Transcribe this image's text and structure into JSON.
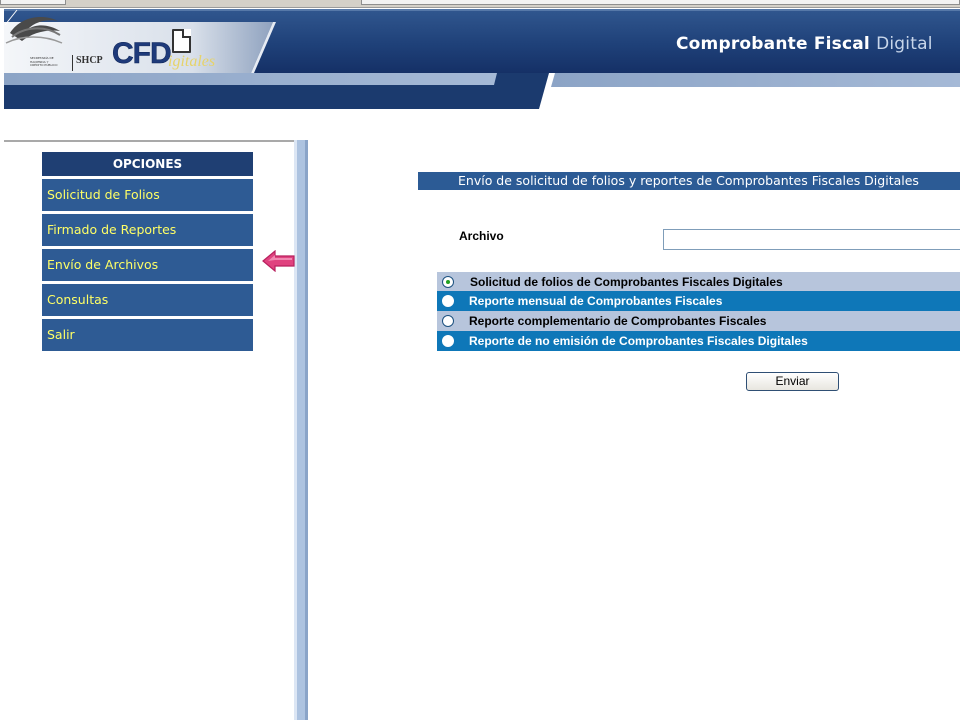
{
  "header": {
    "seal_lines": [
      "SECRETARÍA DE",
      "HACIENDA Y",
      "CRÉDITO PÚBLICO"
    ],
    "seal_abbrev": "SHCP",
    "cfd_letters": "CFD",
    "cfd_script": "igitales",
    "site_title_main": "Comprobante Fiscal ",
    "site_title_accent": "Digital"
  },
  "menu": {
    "header": "OPCIONES",
    "items": [
      {
        "label": "Solicitud de Folios"
      },
      {
        "label": "Firmado de Reportes"
      },
      {
        "label": "Envío de Archivos"
      },
      {
        "label": "Consultas"
      },
      {
        "label": "Salir"
      }
    ]
  },
  "content": {
    "section_title": "Envío de solicitud de folios y reportes de Comprobantes Fiscales Digitales",
    "file_label": "Archivo",
    "file_value": "",
    "options": [
      {
        "label": "Solicitud de folios de Comprobantes Fiscales Digitales",
        "checked": true
      },
      {
        "label": "Reporte mensual de Comprobantes Fiscales",
        "checked": false
      },
      {
        "label": "Reporte complementario de Comprobantes Fiscales",
        "checked": false
      },
      {
        "label": "Reporte de no emisión de Comprobantes Fiscales Digitales",
        "checked": false
      }
    ],
    "submit_label": "Enviar"
  },
  "colors": {
    "banner_dark": "#1b3a6e",
    "menu_header": "#1f3f73",
    "menu_item": "#2e5b94",
    "menu_text": "#ffff66",
    "option_light": "#b7c5dc",
    "option_dark": "#0e77b8",
    "arrow": "#e0427f"
  },
  "icons": {
    "pointer": "left-arrow-icon"
  }
}
